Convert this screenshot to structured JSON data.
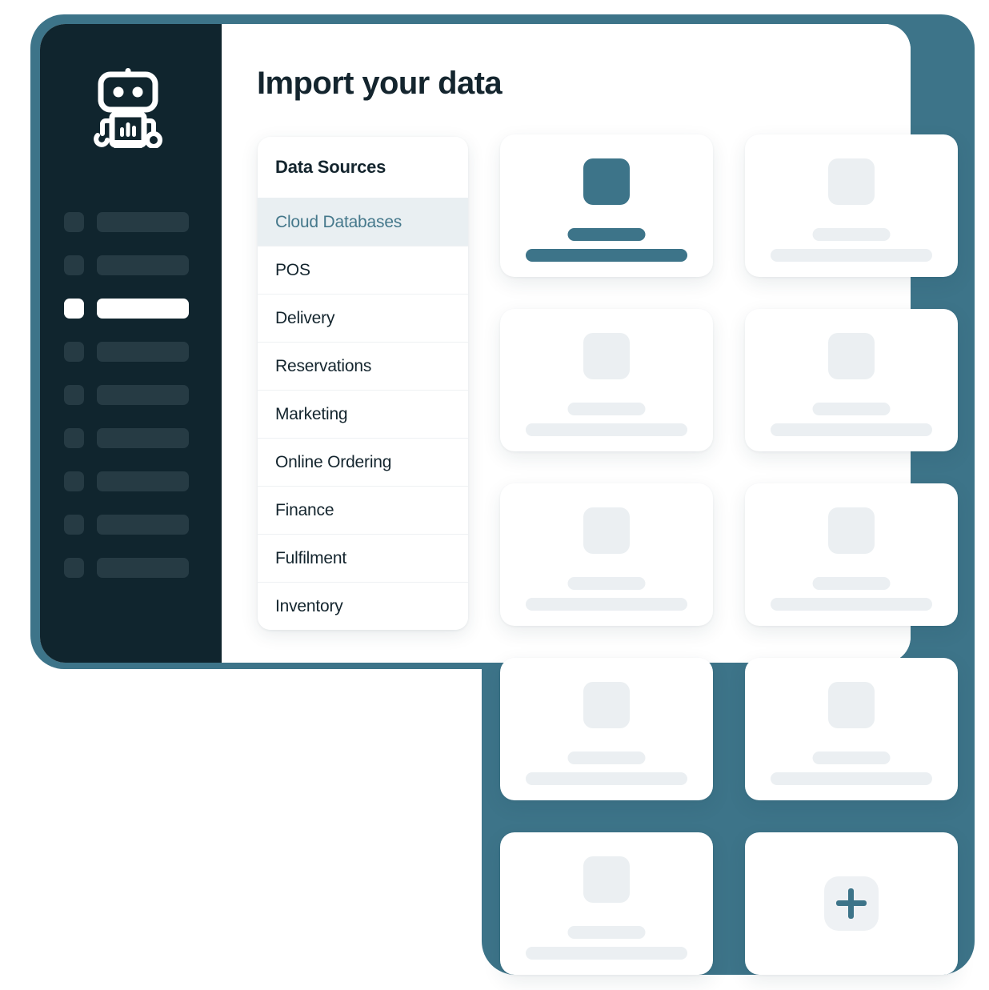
{
  "window": {
    "title": "Import your data",
    "brand_icon": "robot-logo-icon",
    "accent_color": "#3d7489",
    "sidebar_color": "#10252e",
    "nav_placeholder_color": "#263b44",
    "active_nav_color": "#ffffff",
    "placeholder_gray": "#ebeff2",
    "selected_row_bg": "#e9eff2",
    "selected_row_text": "#45788b"
  },
  "sidebar": {
    "items": [
      {
        "id": "nav-1",
        "label": "",
        "active": false
      },
      {
        "id": "nav-2",
        "label": "",
        "active": false
      },
      {
        "id": "nav-3",
        "label": "",
        "active": true
      },
      {
        "id": "nav-4",
        "label": "",
        "active": false
      },
      {
        "id": "nav-5",
        "label": "",
        "active": false
      },
      {
        "id": "nav-6",
        "label": "",
        "active": false
      },
      {
        "id": "nav-7",
        "label": "",
        "active": false
      },
      {
        "id": "nav-8",
        "label": "",
        "active": false
      },
      {
        "id": "nav-9",
        "label": "",
        "active": false
      }
    ]
  },
  "data_sources": {
    "header": "Data Sources",
    "items": [
      {
        "label": "Cloud Databases",
        "selected": true
      },
      {
        "label": "POS",
        "selected": false
      },
      {
        "label": "Delivery",
        "selected": false
      },
      {
        "label": "Reservations",
        "selected": false
      },
      {
        "label": "Marketing",
        "selected": false
      },
      {
        "label": "Online Ordering",
        "selected": false
      },
      {
        "label": "Finance",
        "selected": false
      },
      {
        "label": "Fulfilment",
        "selected": false
      },
      {
        "label": "Inventory",
        "selected": false
      }
    ]
  },
  "integration_cards": [
    {
      "id": "card-1",
      "type": "integration",
      "featured": true
    },
    {
      "id": "card-2",
      "type": "integration",
      "featured": false
    },
    {
      "id": "card-3",
      "type": "integration",
      "featured": false
    },
    {
      "id": "card-4",
      "type": "integration",
      "featured": false
    },
    {
      "id": "card-5",
      "type": "integration",
      "featured": false
    },
    {
      "id": "card-6",
      "type": "integration",
      "featured": false
    },
    {
      "id": "card-7",
      "type": "integration",
      "featured": false
    },
    {
      "id": "card-8",
      "type": "integration",
      "featured": false
    },
    {
      "id": "card-9",
      "type": "integration",
      "featured": false
    },
    {
      "id": "card-10",
      "type": "add",
      "icon": "plus-icon"
    }
  ]
}
